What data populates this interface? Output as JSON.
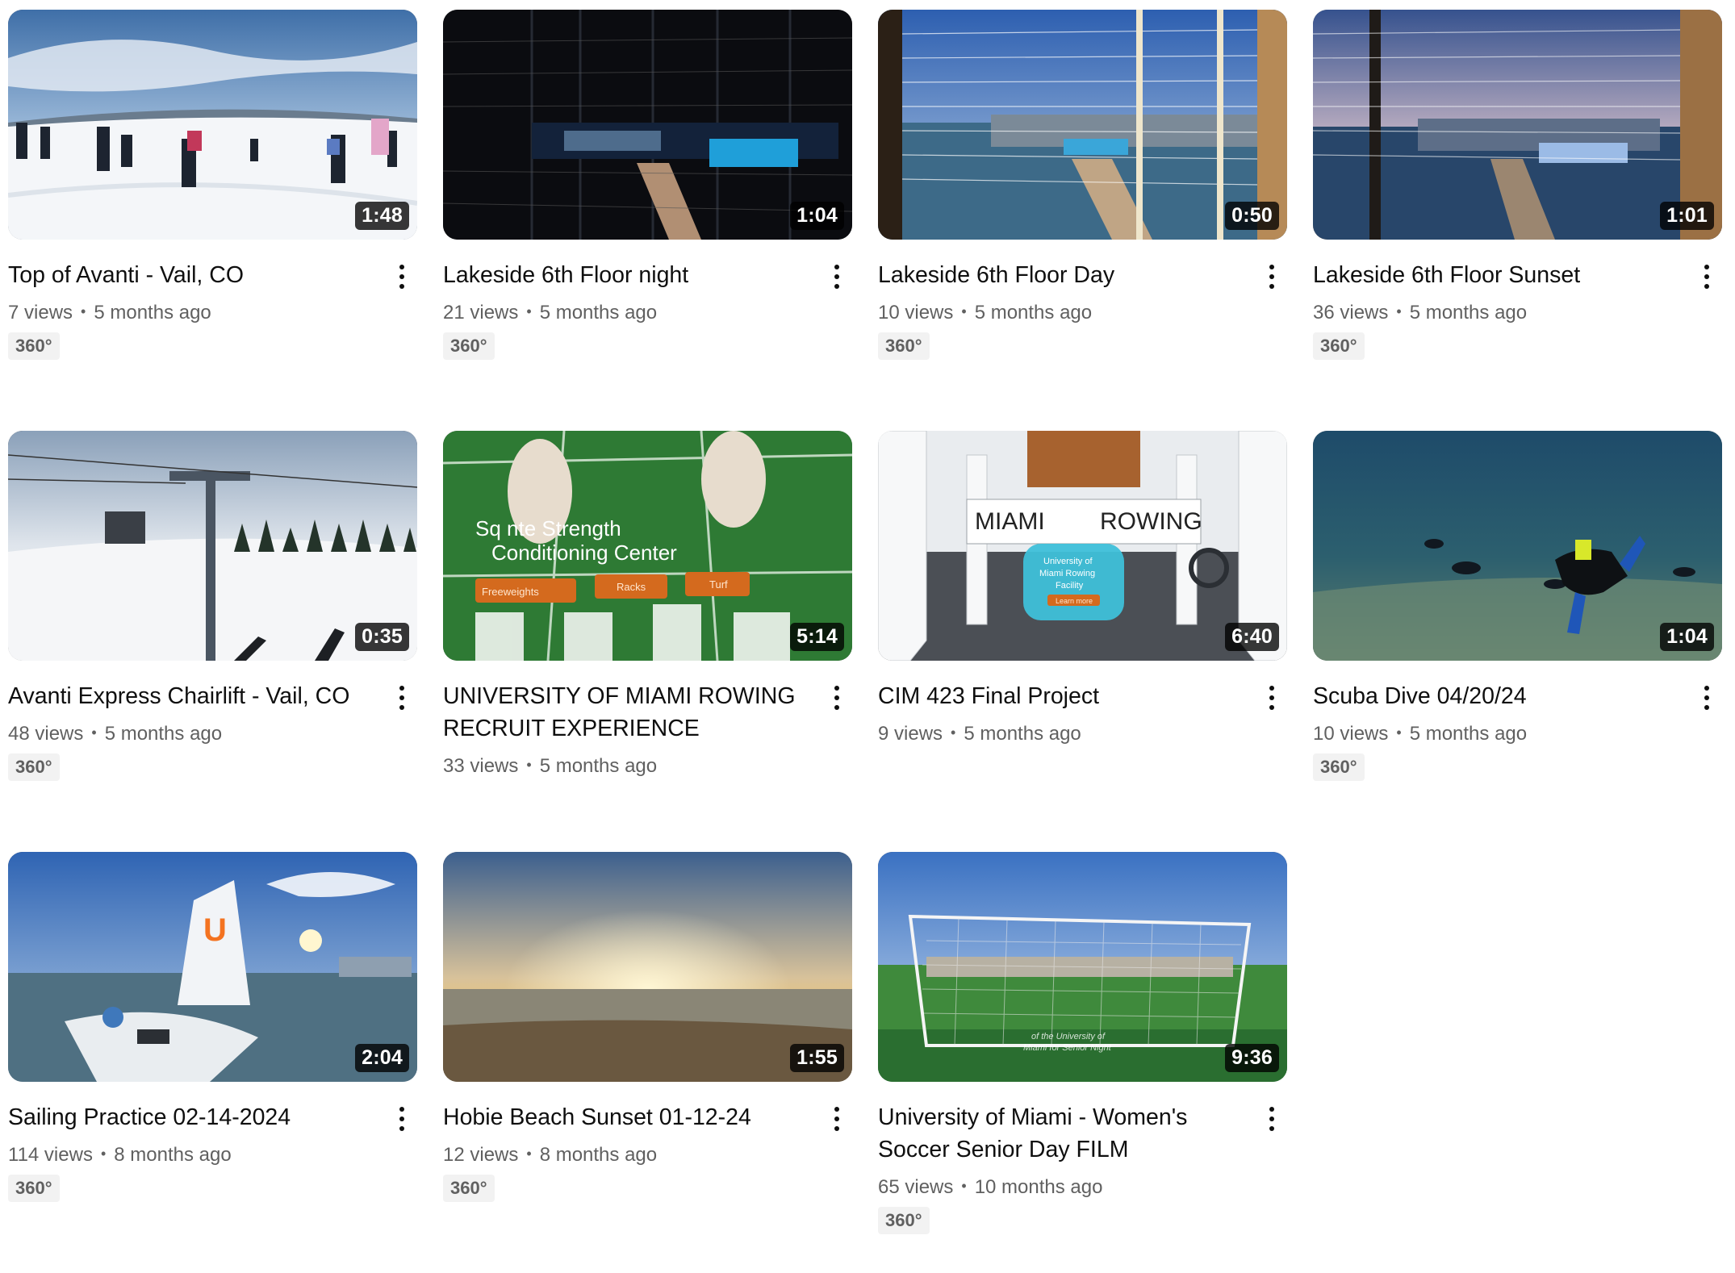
{
  "videos": [
    {
      "title": "Top of Avanti - Vail, CO",
      "views": "7 views",
      "age": "5 months ago",
      "duration": "1:48",
      "badge": "360°",
      "thumb": "snow-skiers"
    },
    {
      "title": "Lakeside 6th Floor night",
      "views": "21 views",
      "age": "5 months ago",
      "duration": "1:04",
      "badge": "360°",
      "thumb": "balcony-night"
    },
    {
      "title": "Lakeside 6th Floor Day",
      "views": "10 views",
      "age": "5 months ago",
      "duration": "0:50",
      "badge": "360°",
      "thumb": "balcony-day"
    },
    {
      "title": "Lakeside 6th Floor Sunset",
      "views": "36 views",
      "age": "5 months ago",
      "duration": "1:01",
      "badge": "360°",
      "thumb": "balcony-sunset"
    },
    {
      "title": "Avanti Express Chairlift - Vail, CO",
      "views": "48 views",
      "age": "5 months ago",
      "duration": "0:35",
      "badge": "360°",
      "thumb": "chairlift"
    },
    {
      "title": "UNIVERSITY OF MIAMI ROWING RECRUIT EXPERIENCE",
      "views": "33 views",
      "age": "5 months ago",
      "duration": "5:14",
      "badge": "",
      "thumb": "vr-field"
    },
    {
      "title": "CIM 423 Final Project",
      "views": "9 views",
      "age": "5 months ago",
      "duration": "6:40",
      "badge": "",
      "thumb": "vr-rowing-hall"
    },
    {
      "title": "Scuba Dive 04/20/24",
      "views": "10 views",
      "age": "5 months ago",
      "duration": "1:04",
      "badge": "360°",
      "thumb": "underwater"
    },
    {
      "title": "Sailing Practice 02-14-2024",
      "views": "114 views",
      "age": "8 months ago",
      "duration": "2:04",
      "badge": "360°",
      "thumb": "sailing"
    },
    {
      "title": "Hobie Beach Sunset 01-12-24",
      "views": "12 views",
      "age": "8 months ago",
      "duration": "1:55",
      "badge": "360°",
      "thumb": "beach-sunset"
    },
    {
      "title": "University of Miami - Women's Soccer Senior Day FILM",
      "views": "65 views",
      "age": "10 months ago",
      "duration": "9:36",
      "badge": "360°",
      "thumb": "soccer-goal"
    }
  ],
  "thumb_texts": {
    "vr_field_line1": "Sq    nte Strength",
    "vr_field_line2": "Conditioning Center",
    "vr_field_btn1": "Freeweights",
    "vr_field_btn2": "Racks",
    "vr_field_btn3": "Turf",
    "rowing_left": "MIAMI",
    "rowing_right": "ROWING",
    "rowing_panel1": "University of",
    "rowing_panel2": "Miami Rowing",
    "rowing_panel3": "Facility",
    "rowing_panel_btn": "Learn more",
    "soccer_caption1": "of the University of",
    "soccer_caption2": "Miami for Senior Night"
  },
  "colors": {
    "title": "#0f0f0f",
    "meta": "#606060",
    "badge_bg": "#f2f2f2",
    "duration_bg": "#000000"
  }
}
